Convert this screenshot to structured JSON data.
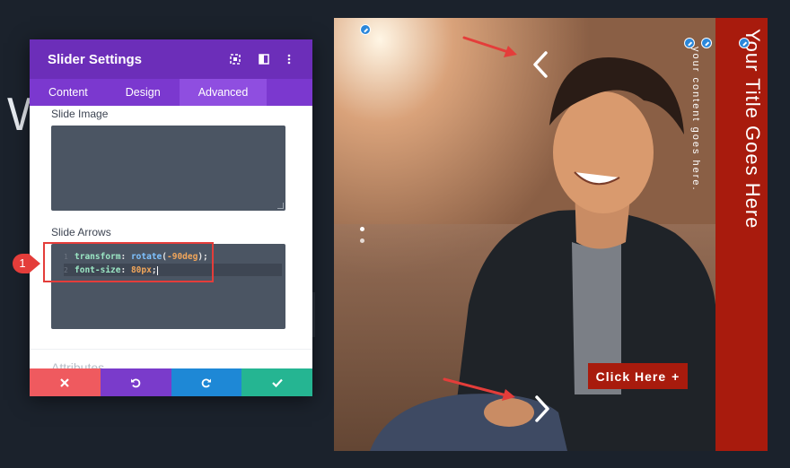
{
  "panel": {
    "title": "Slider Settings",
    "header_icons": [
      "expand-icon",
      "columns-icon",
      "more-vertical-icon"
    ],
    "tabs": [
      {
        "label": "Content",
        "active": false
      },
      {
        "label": "Design",
        "active": false
      },
      {
        "label": "Advanced",
        "active": true
      }
    ],
    "slide_image_label": "Slide Image",
    "slide_arrows_label": "Slide Arrows",
    "code": {
      "line_numbers": [
        "1",
        "2"
      ],
      "line1": {
        "prop": "transform",
        "colon": ": ",
        "fn": "rotate",
        "open": "(",
        "value": "-90deg",
        "close": ");"
      },
      "line2": {
        "prop": "font-size",
        "colon": ": ",
        "value": "80px",
        "end": ";"
      }
    },
    "attributes_label": "Attributes",
    "footer_icons": [
      "close-icon",
      "undo-icon",
      "redo-icon",
      "check-icon"
    ]
  },
  "callout": {
    "number": "1"
  },
  "background": {
    "partial_letter": "W"
  },
  "preview": {
    "title": "Your Title Goes Here",
    "content": "your content goes here.",
    "button_label": "Click Here",
    "button_symbol": "+"
  },
  "colors": {
    "panel_header": "#6c2eb9",
    "tab_bar": "#7b38cf",
    "accent_red": "#a81b0d",
    "highlight": "#e43d3a",
    "save": "#25b592",
    "undo": "#7a3bcb",
    "redo": "#1e88d6",
    "cancel": "#ef5a5f"
  }
}
